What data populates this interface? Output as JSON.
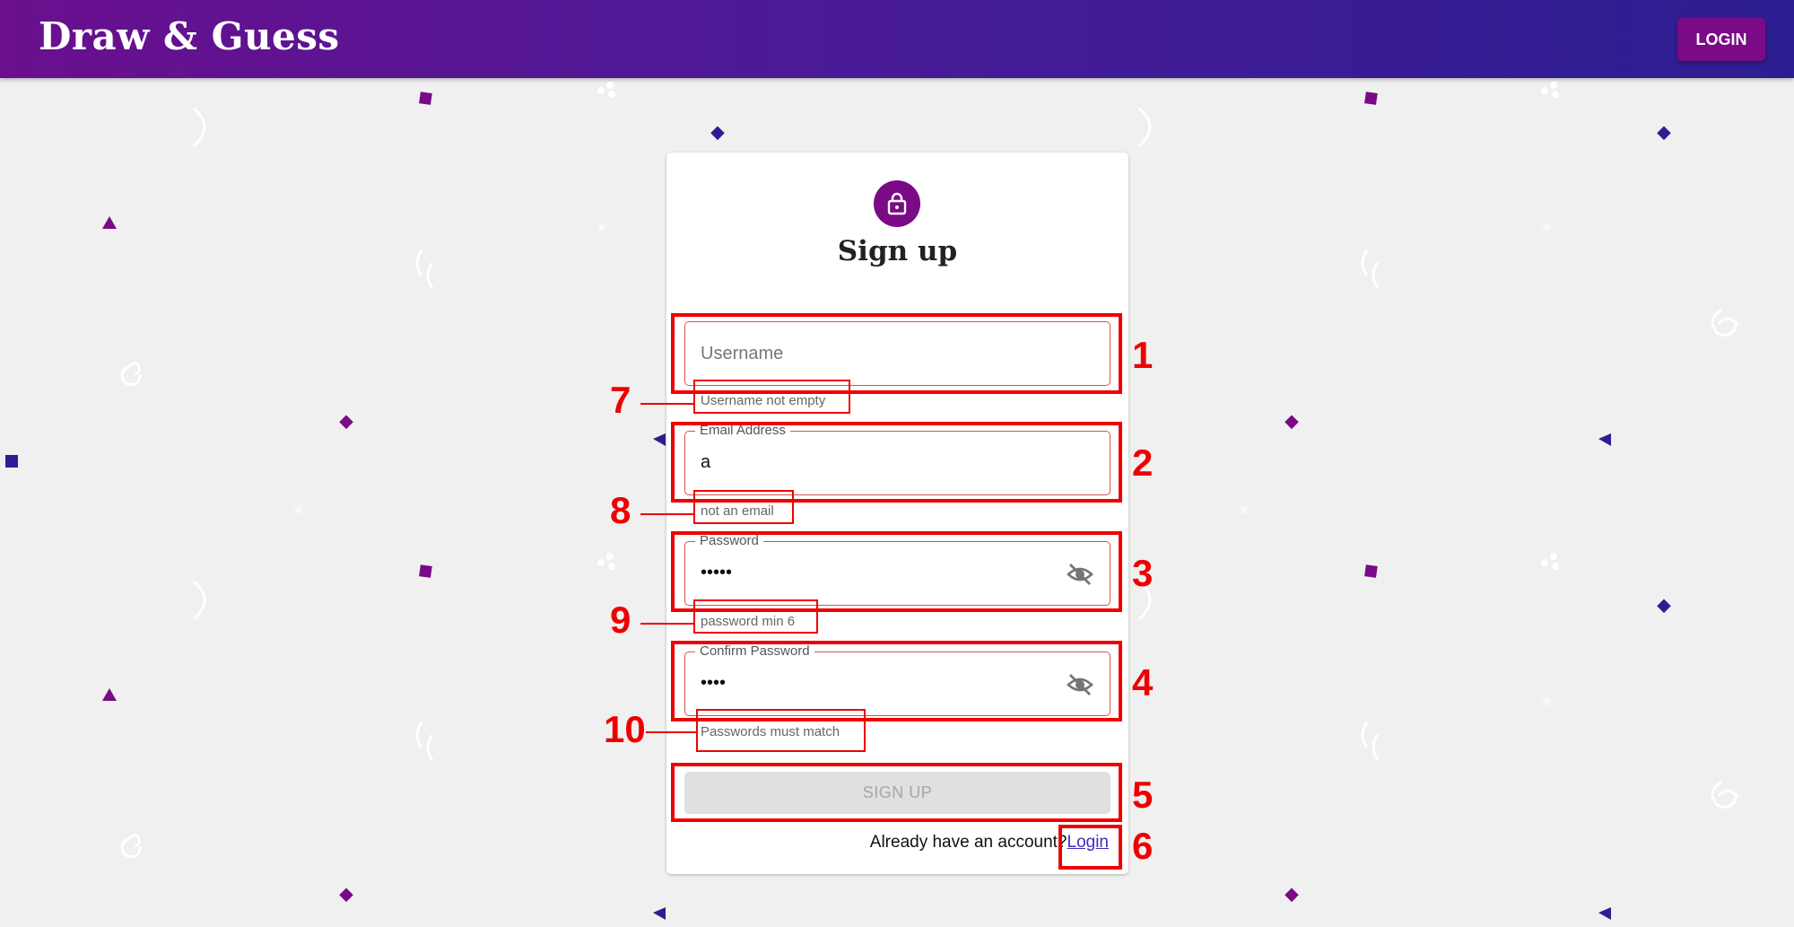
{
  "app": {
    "brand": "Draw & Guess",
    "login_button": "LOGIN"
  },
  "form": {
    "title": "Sign up",
    "lock_icon": "lock-icon",
    "fields": {
      "username": {
        "placeholder": "Username",
        "value": "",
        "helper": "Username not empty"
      },
      "email": {
        "label": "Email Address",
        "value": "a",
        "helper": "not an email"
      },
      "password": {
        "label": "Password",
        "value": "•••••",
        "helper": "password min 6",
        "toggle_icon": "eye-off-icon"
      },
      "confirm": {
        "label": "Confirm Password",
        "value": "••••",
        "helper": "Passwords must match",
        "toggle_icon": "eye-off-icon"
      }
    },
    "submit": "SIGN UP",
    "footer_text": "Already have an account?",
    "footer_link": "Login"
  },
  "annotations": [
    "1",
    "2",
    "3",
    "4",
    "5",
    "6",
    "7",
    "8",
    "9",
    "10"
  ],
  "colors": {
    "brand_purple": "#7a0a86",
    "error": "#d9534f",
    "annotation_red": "#ee0000",
    "navy": "#2c1e92"
  }
}
